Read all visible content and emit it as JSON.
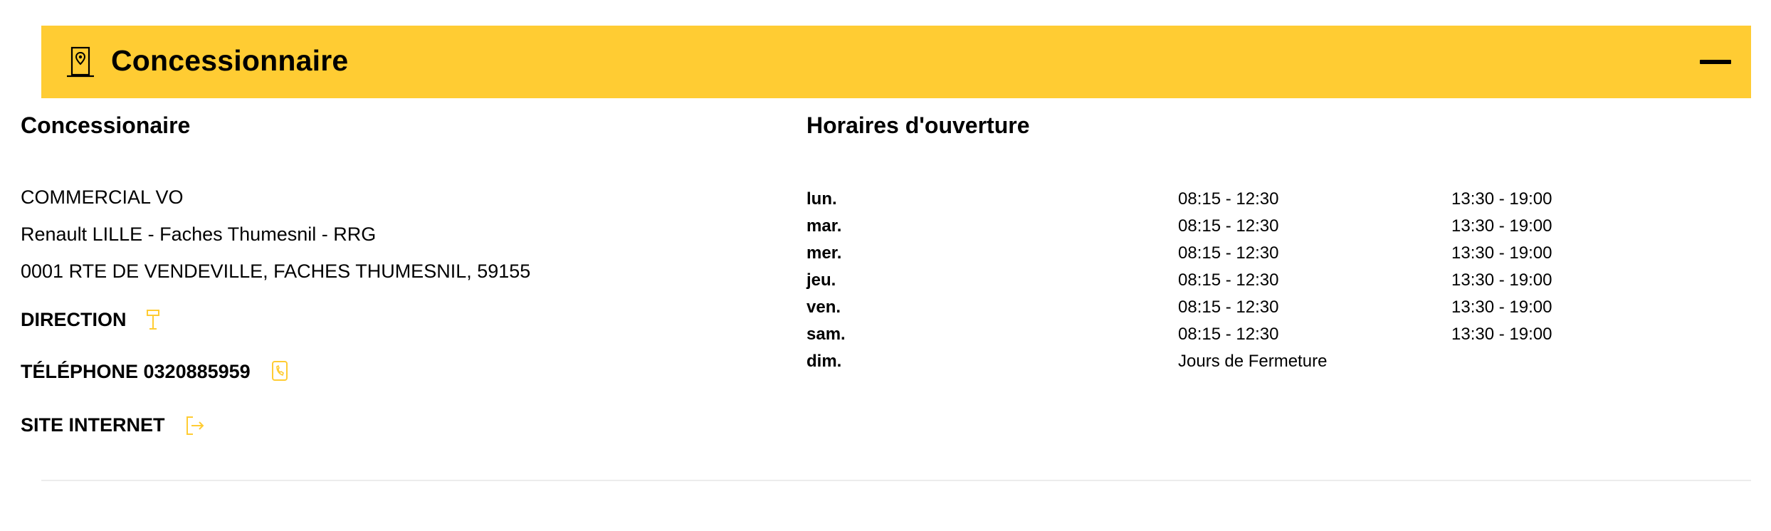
{
  "header": {
    "title": "Concessionnaire",
    "icon": "dealer-location-icon",
    "collapse_icon": "minus-icon",
    "background": "#ffcc33"
  },
  "dealer": {
    "heading": "Concessionaire",
    "name": "COMMERCIAL VO",
    "branch": "Renault LILLE - Faches Thumesnil - RRG",
    "address": "0001 RTE DE VENDEVILLE, FACHES THUMESNIL, 59155",
    "direction_label": "DIRECTION",
    "direction_icon": "signpost-icon",
    "phone_label": "TÉLÉPHONE 0320885959",
    "phone_icon": "phone-icon",
    "website_label": "SITE INTERNET",
    "website_icon": "external-link-icon",
    "accent": "#ffcc33"
  },
  "hours": {
    "heading": "Horaires d'ouverture",
    "rows": [
      {
        "day": "lun.",
        "am": "08:15 - 12:30",
        "pm": "13:30 - 19:00"
      },
      {
        "day": "mar.",
        "am": "08:15 - 12:30",
        "pm": "13:30 - 19:00"
      },
      {
        "day": "mer.",
        "am": "08:15 - 12:30",
        "pm": "13:30 - 19:00"
      },
      {
        "day": "jeu.",
        "am": "08:15 - 12:30",
        "pm": "13:30 - 19:00"
      },
      {
        "day": "ven.",
        "am": "08:15 - 12:30",
        "pm": "13:30 - 19:00"
      },
      {
        "day": "sam.",
        "am": "08:15 - 12:30",
        "pm": "13:30 - 19:00"
      },
      {
        "day": "dim.",
        "am": "Jours de Fermeture",
        "pm": ""
      }
    ]
  }
}
